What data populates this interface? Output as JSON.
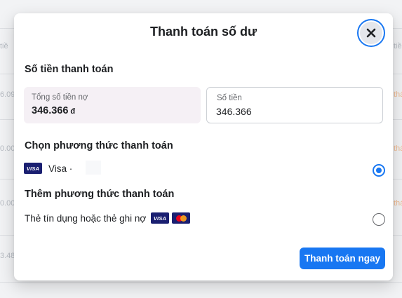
{
  "background": {
    "texts": [
      "tiề",
      "6.09",
      "0.00",
      "0.00",
      "3.48"
    ],
    "right_texts": [
      "tiề",
      "thá",
      "thá",
      "thá"
    ]
  },
  "dialog": {
    "title": "Thanh toán số dư",
    "close_icon": "close-icon",
    "amount_section": {
      "heading": "Số tiền thanh toán",
      "total_label": "Tổng số tiền nợ",
      "total_value": "346.366",
      "total_currency": "đ",
      "amount_label": "Số tiền",
      "amount_value": "346.366"
    },
    "choose_method": {
      "heading": "Chọn phương thức thanh toán",
      "card_brand": "VISA",
      "card_label": "Visa ·",
      "selected": true
    },
    "add_method": {
      "heading": "Thêm phương thức thanh toán",
      "option_label": "Thẻ tín dụng hoặc thẻ ghi nợ",
      "brands": [
        "VISA",
        "mastercard"
      ],
      "selected": false
    },
    "submit_label": "Thanh toán ngay"
  },
  "colors": {
    "accent": "#1877f2",
    "visa": "#1a1f71",
    "mastercard_red": "#eb001b",
    "mastercard_orange": "#f79e1b"
  }
}
